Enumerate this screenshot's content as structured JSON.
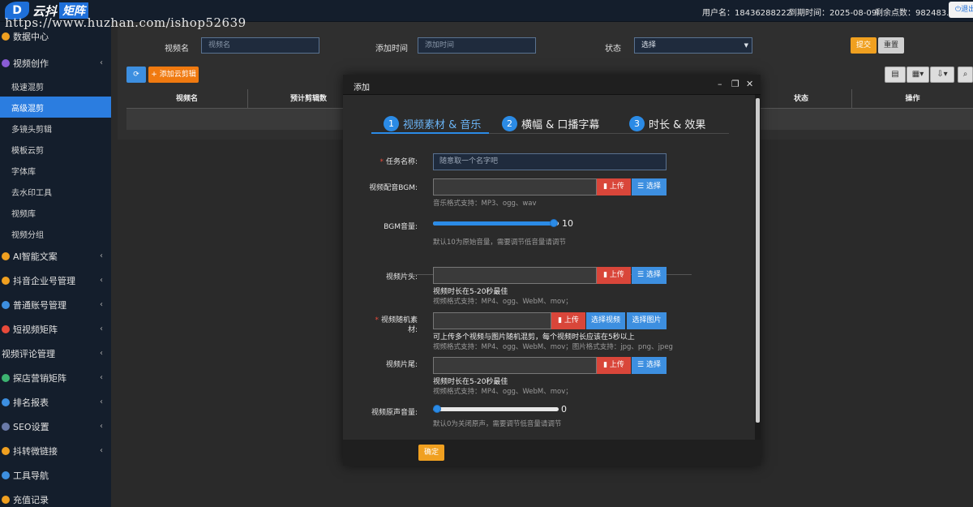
{
  "watermark": "https://www.huzhan.com/ishop52639",
  "topbar": {
    "logo_mark": "D",
    "logo_text": "云抖",
    "logo_tag": "矩阵",
    "username": "用户名：18436288222",
    "expire": "到期时间：2025-08-09",
    "points": "剩余点数：982483.00",
    "exit_label": "退出"
  },
  "sidebar": {
    "items": [
      {
        "label": "数据中心",
        "color": "#f0a020",
        "chevron": ""
      },
      {
        "label": "视频创作",
        "color": "#8a5cd6",
        "chevron": "‹"
      },
      {
        "label": "AI智能文案",
        "color": "#f0a020",
        "chevron": "‹"
      },
      {
        "label": "抖音企业号管理",
        "color": "#f0a020",
        "chevron": "‹"
      },
      {
        "label": "普通账号管理",
        "color": "#3d8fe0",
        "chevron": "‹"
      },
      {
        "label": "短视频矩阵",
        "color": "#e84a3a",
        "chevron": "‹"
      },
      {
        "label": "视频评论管理",
        "color": "",
        "chevron": "‹"
      },
      {
        "label": "探店营销矩阵",
        "color": "#3cb371",
        "chevron": "‹"
      },
      {
        "label": "排名报表",
        "color": "#3d8fe0",
        "chevron": "‹"
      },
      {
        "label": "SEO设置",
        "color": "#6a7aa8",
        "chevron": "‹"
      },
      {
        "label": "抖转微链接",
        "color": "#f0a020",
        "chevron": "‹"
      },
      {
        "label": "工具导航",
        "color": "#3d8fe0",
        "chevron": ""
      },
      {
        "label": "充值记录",
        "color": "#f0a020",
        "chevron": ""
      }
    ],
    "sub_items": [
      "极速混剪",
      "高级混剪",
      "多镜头剪辑",
      "模板云剪",
      "字体库",
      "去水印工具",
      "视频库",
      "视频分组"
    ]
  },
  "filters": {
    "name_label": "视频名",
    "name_placeholder": "视频名",
    "time_label": "添加时间",
    "time_placeholder": "添加时间",
    "status_label": "状态",
    "status_value": "选择",
    "submit_label": "提交",
    "reset_label": "重置"
  },
  "toolbar": {
    "add_label": "+ 添加云剪辑"
  },
  "table": {
    "columns": [
      "视频名",
      "预计剪辑数",
      "状态",
      "操作"
    ]
  },
  "modal": {
    "title": "添加",
    "steps": [
      {
        "num": "1",
        "label": "视频素材 & 音乐"
      },
      {
        "num": "2",
        "label": "横幅 & 口播字幕"
      },
      {
        "num": "3",
        "label": "时长 & 效果"
      }
    ],
    "task_name_label": "任务名称:",
    "task_name_placeholder": "随意取一个名字吧",
    "bgm_label": "视频配音BGM:",
    "bgm_hint": "音乐格式支持：MP3、ogg、wav",
    "upload_label": "上传",
    "select_label": "选择",
    "bgm_volume_label": "BGM音量:",
    "bgm_volume_value": "10",
    "bgm_volume_fraction": 1.0,
    "bgm_volume_hint": "默认10为原始音量，需要调节低音量请调节",
    "intro_label": "视频片头:",
    "intro_hint_strong": "视频时长在5-20秒最佳",
    "intro_hint": "视频格式支持：MP4、ogg、WebM、mov；",
    "random_label_1": "视频随机素",
    "random_label_2": "材:",
    "select_video_label": "选择视频",
    "select_image_label": "选择图片",
    "random_hint_strong": "可上传多个视频与图片随机混剪，每个视频时长应该在5秒以上",
    "random_hint": "视频格式支持：MP4、ogg、WebM、mov；图片格式支持：jpg、png、jpeg",
    "outro_label": "视频片尾:",
    "outro_hint_strong": "视频时长在5-20秒最佳",
    "outro_hint": "视频格式支持：MP4、ogg、WebM、mov；",
    "orig_volume_label": "视频原声音量:",
    "orig_volume_value": "0",
    "orig_volume_fraction": 0.0,
    "orig_volume_hint": "默认0为关闭原声，需要调节低音量请调节",
    "confirm_label": "确定"
  },
  "colors": {
    "accent": "#2b8be6",
    "sidebar_bg": "#141e2c",
    "danger": "#d9463a",
    "warning": "#f0a020"
  }
}
